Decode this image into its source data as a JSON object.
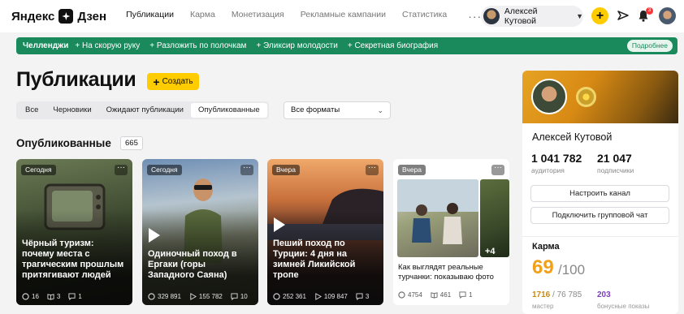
{
  "nav": {
    "logo_part1": "Яндекс",
    "logo_part2": "Дзен",
    "links": [
      "Публикации",
      "Карма",
      "Монетизация",
      "Рекламные кампании",
      "Статистика"
    ],
    "more": "···",
    "account_name": "Алексей Кутовой",
    "notifications_count": "3"
  },
  "challenge": {
    "title": "Челленджи",
    "items": [
      "+ На скорую руку",
      "+ Разложить по полочкам",
      "+ Эликсир молодости",
      "+ Секретная биография"
    ],
    "more_label": "Подробнее"
  },
  "page": {
    "title": "Публикации",
    "create_label": "Создать",
    "filters": [
      "Все",
      "Черновики",
      "Ожидают публикации",
      "Опубликованные"
    ],
    "active_filter": "Опубликованные",
    "format_select": "Все форматы",
    "section_title": "Опубликованные",
    "section_count": "665"
  },
  "cards": [
    {
      "date": "Сегодня",
      "title": "Чёрный туризм: почему места с трагическим прошлым притягивают людей",
      "stats": [
        "16",
        "3",
        "1"
      ],
      "video": false
    },
    {
      "date": "Сегодня",
      "title": "Одиночный поход в Ергаки (горы Западного Саяна)",
      "stats": [
        "329 891",
        "155 782",
        "10"
      ],
      "video": true
    },
    {
      "date": "Вчера",
      "title": "Пеший поход по Турции: 4 дня на зимней Ликийской тропе",
      "stats": [
        "252 361",
        "109 847",
        "3"
      ],
      "video": true
    },
    {
      "date": "Вчера",
      "title": "Как выглядят реальные турчанки: показываю фото",
      "stats": [
        "4754",
        "461",
        "1"
      ],
      "extra_photos": "+4"
    }
  ],
  "profile": {
    "name": "Алексей Кутовой",
    "audience_value": "1 041 782",
    "audience_label": "аудитория",
    "subscribers_value": "21 047",
    "subscribers_label": "подписчики",
    "setup_button": "Настроить канал",
    "group_chat_button": "Подключить групповой чат",
    "karma_title": "Карма",
    "karma_value": "69",
    "karma_max": "/100",
    "master_value": "1716",
    "master_total": "/ 76 785",
    "master_label": "мастер",
    "bonus_value": "203",
    "bonus_label": "бонусные показы"
  },
  "colors": {
    "accent_yellow": "#ffcc00",
    "challenge_green": "#1a8a5c",
    "karma_orange": "#f2a01a",
    "bonus_purple": "#7b3fb8"
  }
}
